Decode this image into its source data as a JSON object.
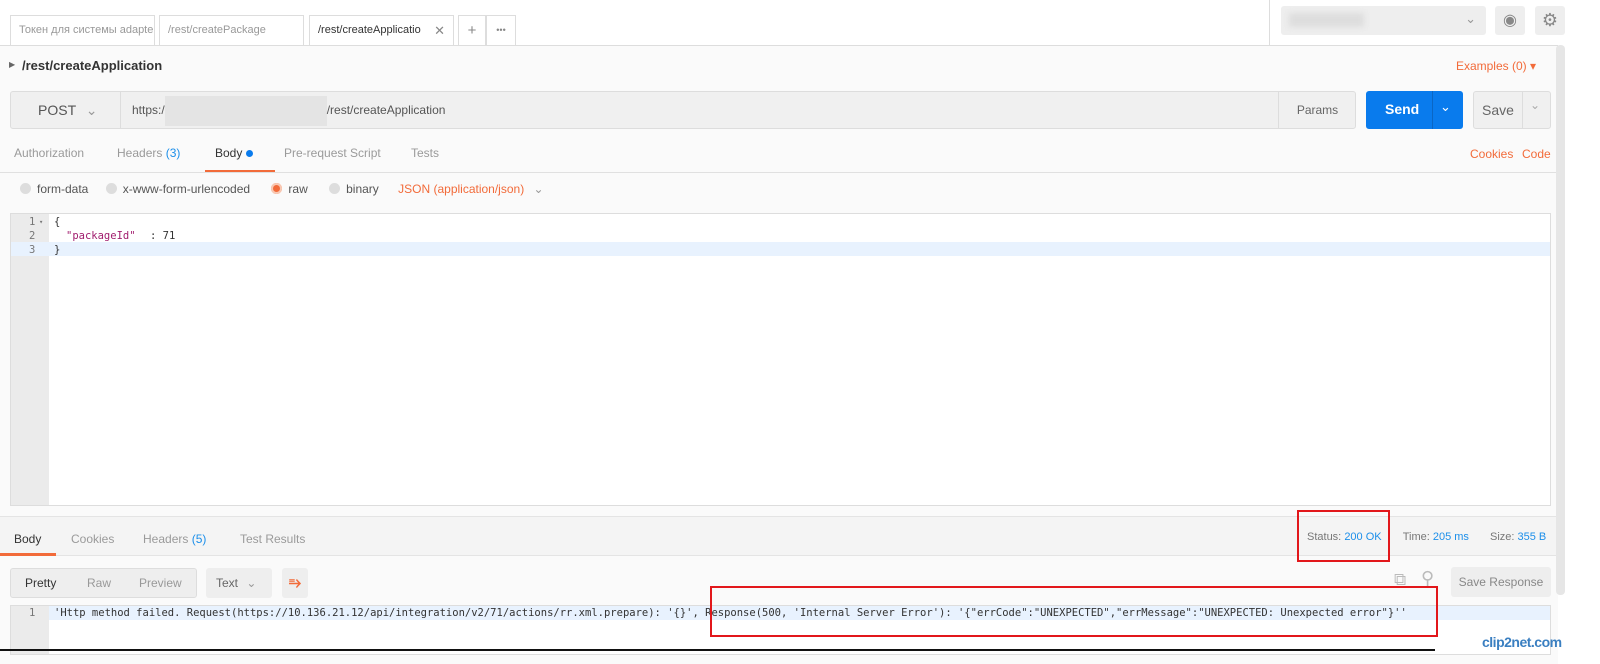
{
  "tabs": [
    {
      "label": "Токен для системы adapte"
    },
    {
      "label": "/rest/createPackage"
    },
    {
      "label": "/rest/createApplicatio",
      "active": true
    }
  ],
  "tab_actions": {
    "add": "+",
    "more": "•••"
  },
  "request": {
    "title": "/rest/createApplication",
    "examples": "Examples (0)",
    "method": "POST",
    "url_prefix": "https:/",
    "url_suffix": "/rest/createApplication",
    "params": "Params",
    "send": "Send",
    "save": "Save"
  },
  "request_tabs": [
    {
      "label": "Authorization"
    },
    {
      "label": "Headers",
      "count": "(3)"
    },
    {
      "label": "Body",
      "active": true
    },
    {
      "label": "Pre-request Script"
    },
    {
      "label": "Tests"
    }
  ],
  "links": {
    "cookies": "Cookies",
    "code": "Code"
  },
  "body_modes": [
    {
      "label": "form-data"
    },
    {
      "label": "x-www-form-urlencoded"
    },
    {
      "label": "raw",
      "selected": true
    },
    {
      "label": "binary"
    }
  ],
  "content_type": "JSON (application/json)",
  "editor": {
    "lines": [
      {
        "n": "1",
        "text": "{"
      },
      {
        "n": "2",
        "key": "\"packageId\"",
        "rest": ": 71"
      },
      {
        "n": "3",
        "text": "}"
      }
    ]
  },
  "response_tabs": [
    {
      "label": "Body",
      "active": true
    },
    {
      "label": "Cookies"
    },
    {
      "label": "Headers",
      "count": "(5)"
    },
    {
      "label": "Test Results"
    }
  ],
  "status": {
    "status_label": "Status:",
    "status_value": "200 OK",
    "time_label": "Time:",
    "time_value": "205 ms",
    "size_label": "Size:",
    "size_value": "355 B"
  },
  "view_modes": {
    "pretty": "Pretty",
    "raw": "Raw",
    "preview": "Preview",
    "format": "Text"
  },
  "save_response": "Save Response",
  "response": {
    "line_no": "1",
    "text": "'Http method failed. Request(https://10.136.21.12/api/integration/v2/71/actions/rr.xml.prepare): '{}', Response(500, 'Internal Server Error'): '{\"errCode\":\"UNEXPECTED\",\"errMessage\":\"UNEXPECTED: Unexpected error\"}''"
  },
  "watermark": "clip2net.com",
  "colors": {
    "accent": "#f26b3a",
    "send": "#097bed",
    "link": "#1c8fea",
    "highlight": "#e2171b"
  }
}
